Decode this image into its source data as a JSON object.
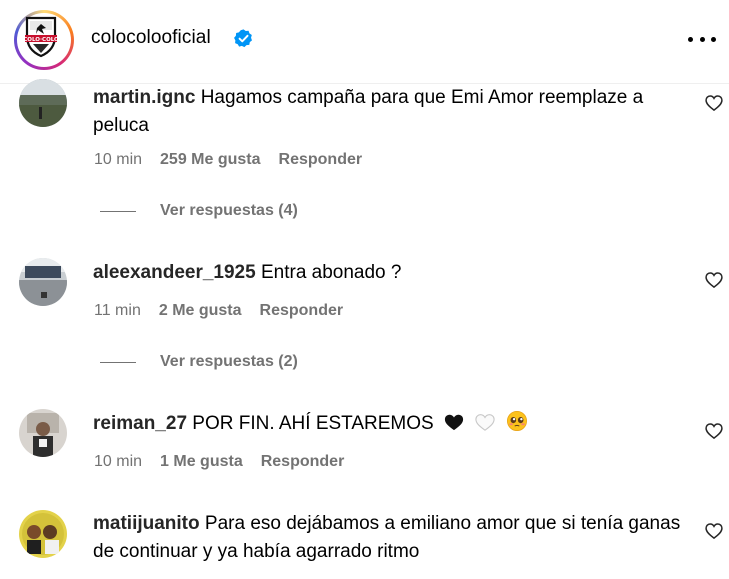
{
  "header": {
    "username": "colocolooficial",
    "logo_text": "COLO COLO",
    "verified_icon": "verified-badge-icon",
    "more_icon": "more-options-icon"
  },
  "comments": [
    {
      "username": "martin.ignc",
      "text": "Hagamos campaña para que Emi Amor reemplaze a peluca",
      "time": "10 min",
      "likes": "259 Me gusta",
      "reply": "Responder",
      "replies": "Ver respuestas (4)"
    },
    {
      "username": "aleexandeer_1925",
      "text": "Entra abonado ?",
      "time": "11 min",
      "likes": "2 Me gusta",
      "reply": "Responder",
      "replies": "Ver respuestas (2)"
    },
    {
      "username": "reiman_27",
      "text": "POR FIN. AHÍ ESTAREMOS",
      "emojis": [
        "black-heart",
        "white-heart",
        "pleading-face"
      ],
      "time": "10 min",
      "likes": "1 Me gusta",
      "reply": "Responder"
    },
    {
      "username": "matiijuanito",
      "text": "Para eso dejábamos a emiliano amor que si tenía ganas de continuar y ya había agarrado ritmo"
    }
  ],
  "colors": {
    "secondary_text": "#737373",
    "verified_blue": "#0095f6"
  }
}
